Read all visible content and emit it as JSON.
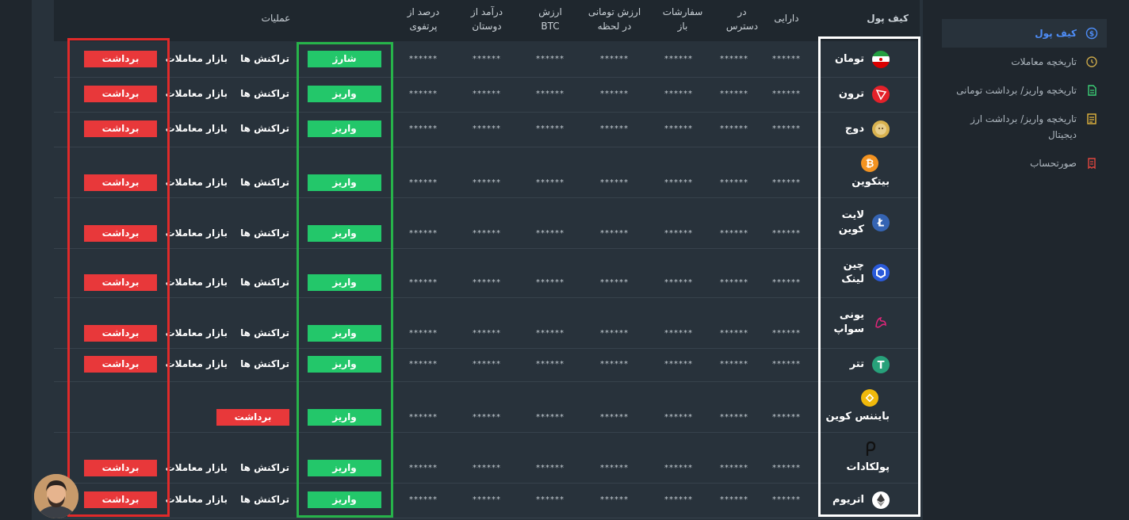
{
  "headers": {
    "wallet": "کیف پول",
    "assets": "دارایی",
    "available": "در\nدسترس",
    "open_orders": "سفارشات\nباز",
    "toman_value": "ارزش تومانی\nدر لحظه",
    "btc_value": "ارزش\nBTC",
    "friends_income": "درآمد از\nدوستان",
    "portfolio_percent": "درصد از\nپرتفوی",
    "operations": "عملیات"
  },
  "masked": "******",
  "rows": [
    {
      "name": "تومان",
      "deposit": "شارژ",
      "tx": "تراکنش ها",
      "market": "بازار معاملات",
      "withdraw": "برداشت",
      "icon": "iran-flag-icon",
      "color": "#ffffff"
    },
    {
      "name": "ترون",
      "deposit": "واریز",
      "tx": "تراکنش ها",
      "market": "بازار معاملات",
      "withdraw": "برداشت",
      "icon": "tron-icon",
      "color": "#e3212a"
    },
    {
      "name": "دوج",
      "deposit": "واریز",
      "tx": "تراکنش ها",
      "market": "بازار معاملات",
      "withdraw": "برداشت",
      "icon": "doge-icon",
      "color": "#d9b24f"
    },
    {
      "name": "بیتکوین",
      "deposit": "واریز",
      "tx": "تراکنش ها",
      "market": "بازار معاملات",
      "withdraw": "برداشت",
      "icon": "bitcoin-icon",
      "color": "#f39321"
    },
    {
      "name": "لایت\nکوین",
      "deposit": "واریز",
      "tx": "تراکنش ها",
      "market": "بازار معاملات",
      "withdraw": "برداشت",
      "icon": "litecoin-icon",
      "color": "#3564b3"
    },
    {
      "name": "چین\nلینک",
      "deposit": "واریز",
      "tx": "تراکنش ها",
      "market": "بازار معاملات",
      "withdraw": "برداشت",
      "icon": "chainlink-icon",
      "color": "#2a5ada"
    },
    {
      "name": "یونی\nسواپ",
      "deposit": "واریز",
      "tx": "تراکنش ها",
      "market": "بازار معاملات",
      "withdraw": "برداشت",
      "icon": "uniswap-icon",
      "color": "#e0267a"
    },
    {
      "name": "تتر",
      "deposit": "واریز",
      "tx": "تراکنش ها",
      "market": "بازار معاملات",
      "withdraw": "برداشت",
      "icon": "tether-icon",
      "color": "#27a17a"
    },
    {
      "name": "بایننس کوین",
      "deposit": "واریز",
      "tx": "",
      "market": "",
      "withdraw": "برداشت",
      "icon": "binance-icon",
      "color": "#f0b90b"
    },
    {
      "name": "پولکادات",
      "deposit": "واریز",
      "tx": "تراکنش ها",
      "market": "بازار معاملات",
      "withdraw": "برداشت",
      "icon": "polkadot-icon",
      "color": "#1a1a1a"
    },
    {
      "name": "اتریوم",
      "deposit": "واریز",
      "tx": "تراکنش ها",
      "market": "بازار معاملات",
      "withdraw": "برداشت",
      "icon": "ethereum-icon",
      "color": "#ffffff"
    }
  ],
  "sidebar": {
    "items": [
      {
        "label": "کیف پول",
        "icon": "wallet-icon",
        "active": true
      },
      {
        "label": "تاریخچه معاملات",
        "icon": "history-icon",
        "active": false
      },
      {
        "label": "تاریخچه واریز/ برداشت تومانی",
        "icon": "document-icon",
        "active": false
      },
      {
        "label": "تاریخچه واریز/ برداشت ارز دیجیتال",
        "icon": "crypto-history-icon",
        "active": false
      },
      {
        "label": "صورتحساب",
        "icon": "invoice-icon",
        "active": false
      }
    ]
  },
  "colors": {
    "accent": "#4e8df7",
    "deposit": "#23c76a",
    "withdraw": "#e8383a",
    "frame_white": "#ffffff",
    "frame_green": "#27b34a",
    "frame_red": "#e02a2a"
  }
}
